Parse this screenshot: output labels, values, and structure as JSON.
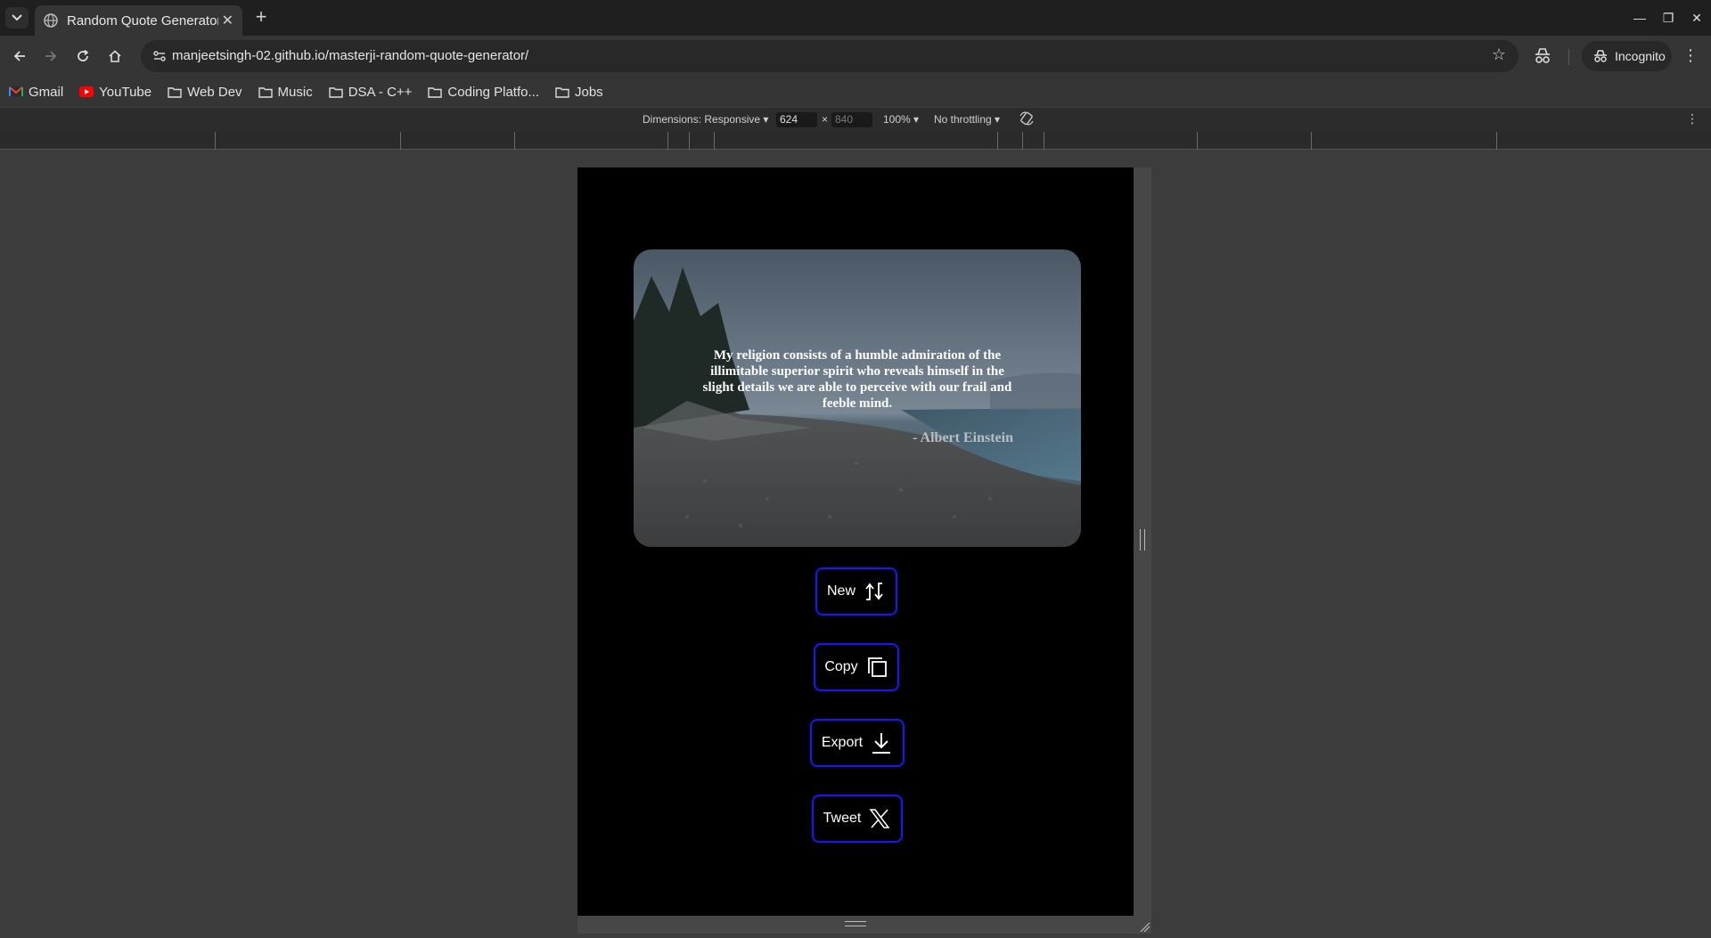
{
  "browser": {
    "tab_title": "Random Quote Generator",
    "url": "manjeetsingh-02.github.io/masterji-random-quote-generator/",
    "incognito_label": "Incognito"
  },
  "bookmarks": [
    {
      "label": "Gmail",
      "icon": "gmail-icon"
    },
    {
      "label": "YouTube",
      "icon": "youtube-icon"
    },
    {
      "label": "Web Dev",
      "icon": "folder-icon"
    },
    {
      "label": "Music",
      "icon": "folder-icon"
    },
    {
      "label": "DSA - C++",
      "icon": "folder-icon"
    },
    {
      "label": "Coding Platfo...",
      "icon": "folder-icon"
    },
    {
      "label": "Jobs",
      "icon": "folder-icon"
    }
  ],
  "devtools": {
    "dimensions_label": "Dimensions: Responsive",
    "width_value": "624",
    "height_value": "840",
    "times": "×",
    "zoom": "100%",
    "throttling": "No throttling"
  },
  "quote": {
    "text": "My religion consists of a humble admiration of the illimitable superior spirit who reveals himself in the slight details we are able to perceive with our frail and feeble mind.",
    "author": "- Albert Einstein"
  },
  "actions": {
    "new_label": "New",
    "copy_label": "Copy",
    "export_label": "Export",
    "tweet_label": "Tweet"
  },
  "colors": {
    "button_border": "#1616ff",
    "page_background": "#000000"
  }
}
